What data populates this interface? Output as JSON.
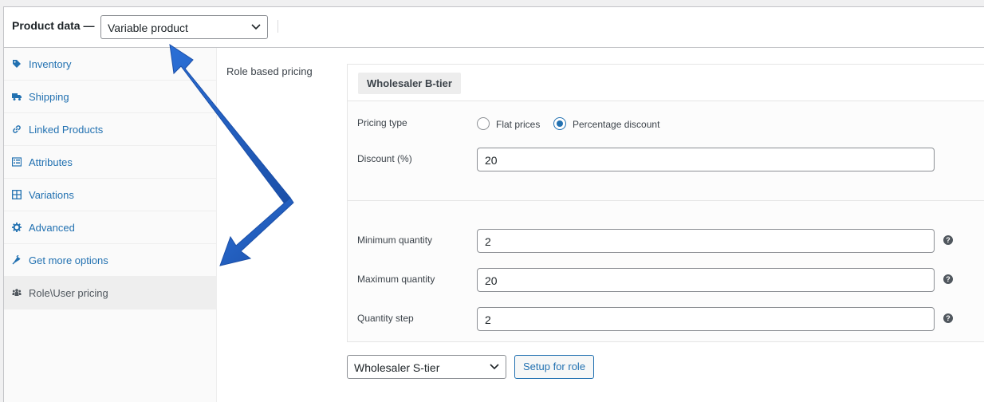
{
  "header": {
    "title": "Product data —",
    "product_type": "Variable product"
  },
  "sidebar": {
    "items": [
      {
        "label": "Inventory",
        "icon": "tag-icon"
      },
      {
        "label": "Shipping",
        "icon": "truck-icon"
      },
      {
        "label": "Linked Products",
        "icon": "link-icon"
      },
      {
        "label": "Attributes",
        "icon": "list-icon"
      },
      {
        "label": "Variations",
        "icon": "grid-icon"
      },
      {
        "label": "Advanced",
        "icon": "gear-icon"
      },
      {
        "label": "Get more options",
        "icon": "plugin-icon"
      },
      {
        "label": "Role\\User pricing",
        "icon": "users-icon",
        "active": true
      }
    ]
  },
  "main": {
    "section_label": "Role based pricing",
    "role_badge": "Wholesaler B-tier",
    "pricing_type_label": "Pricing type",
    "pricing_options": [
      "Flat prices",
      "Percentage discount"
    ],
    "pricing_selected": "Percentage discount",
    "discount_label": "Discount (%)",
    "discount_value": "20",
    "min_qty_label": "Minimum quantity",
    "min_qty_value": "2",
    "max_qty_label": "Maximum quantity",
    "max_qty_value": "20",
    "qty_step_label": "Quantity step",
    "qty_step_value": "2",
    "role_select_value": "Wholesaler S-tier",
    "setup_button": "Setup for role"
  },
  "colors": {
    "accent": "#2271b1",
    "arrow": "#1e5bbf"
  }
}
